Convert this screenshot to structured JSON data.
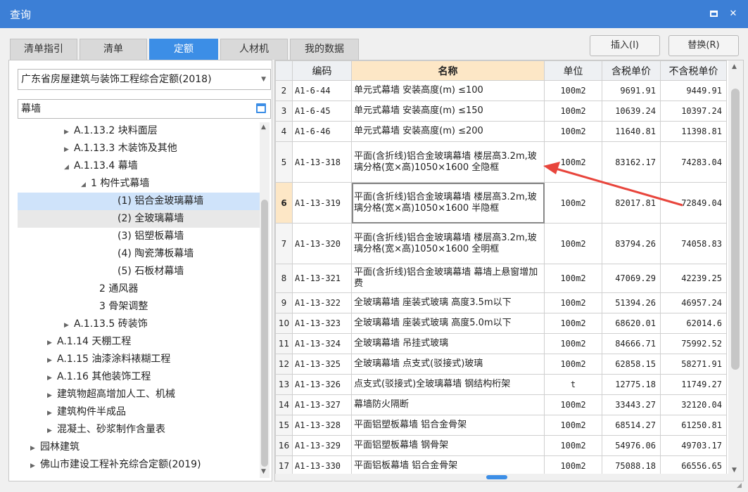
{
  "window": {
    "title": "查询"
  },
  "tabs": [
    {
      "label": "清单指引"
    },
    {
      "label": "清单"
    },
    {
      "label": "定额"
    },
    {
      "label": "人材机"
    },
    {
      "label": "我的数据"
    }
  ],
  "buttons": {
    "insert": "插入(I)",
    "replace": "替换(R)"
  },
  "left": {
    "quota_library": "广东省房屋建筑与装饰工程综合定额(2018)",
    "search_value": "幕墙",
    "tree": [
      {
        "label": "A.1.13.2 块料面层",
        "arrow": "▶"
      },
      {
        "label": "A.1.13.3 木装饰及其他",
        "arrow": "▶"
      },
      {
        "label": "A.1.13.4 幕墙",
        "arrow": "◢"
      },
      {
        "label": "1 构件式幕墙",
        "arrow": "◢"
      },
      {
        "label": "(1) 铝合金玻璃幕墙",
        "arrow": ""
      },
      {
        "label": "(2) 全玻璃幕墙",
        "arrow": ""
      },
      {
        "label": "(3) 铝塑板幕墙",
        "arrow": ""
      },
      {
        "label": "(4) 陶瓷薄板幕墙",
        "arrow": ""
      },
      {
        "label": "(5) 石板材幕墙",
        "arrow": ""
      },
      {
        "label": "2 通风器",
        "arrow": ""
      },
      {
        "label": "3 骨架调整",
        "arrow": ""
      },
      {
        "label": "A.1.13.5 砖装饰",
        "arrow": "▶"
      },
      {
        "label": "A.1.14 天棚工程",
        "arrow": "▶"
      },
      {
        "label": "A.1.15 油漆涂料裱糊工程",
        "arrow": "▶"
      },
      {
        "label": "A.1.16 其他装饰工程",
        "arrow": "▶"
      },
      {
        "label": "建筑物超高增加人工、机械",
        "arrow": "▶"
      },
      {
        "label": "建筑构件半成品",
        "arrow": "▶"
      },
      {
        "label": "混凝土、砂浆制作含量表",
        "arrow": "▶"
      },
      {
        "label": "园林建筑",
        "arrow": "▶"
      },
      {
        "label": "佛山市建设工程补充综合定额(2019)",
        "arrow": "▶"
      }
    ]
  },
  "grid": {
    "headers": [
      "",
      "编码",
      "名称",
      "单位",
      "含税单价",
      "不含税单价"
    ],
    "rows": [
      {
        "idx": "2",
        "code": "A1-6-44",
        "name": "单元式幕墙 安装高度(m) ≤100",
        "unit": "100m2",
        "tax": "9691.91",
        "notax": "9449.91"
      },
      {
        "idx": "3",
        "code": "A1-6-45",
        "name": "单元式幕墙 安装高度(m) ≤150",
        "unit": "100m2",
        "tax": "10639.24",
        "notax": "10397.24"
      },
      {
        "idx": "4",
        "code": "A1-6-46",
        "name": "单元式幕墙 安装高度(m) ≤200",
        "unit": "100m2",
        "tax": "11640.81",
        "notax": "11398.81"
      },
      {
        "idx": "5",
        "code": "A1-13-318",
        "name": "平面(含折线)铝合金玻璃幕墙 楼层高3.2m,玻璃分格(宽×高)1050×1600 全隐框",
        "unit": "100m2",
        "tax": "83162.17",
        "notax": "74283.04"
      },
      {
        "idx": "6",
        "code": "A1-13-319",
        "name": "平面(含折线)铝合金玻璃幕墙 楼层高3.2m,玻璃分格(宽×高)1050×1600 半隐框",
        "unit": "100m2",
        "tax": "82017.81",
        "notax": "72849.04"
      },
      {
        "idx": "7",
        "code": "A1-13-320",
        "name": "平面(含折线)铝合金玻璃幕墙 楼层高3.2m,玻璃分格(宽×高)1050×1600 全明框",
        "unit": "100m2",
        "tax": "83794.26",
        "notax": "74058.83"
      },
      {
        "idx": "8",
        "code": "A1-13-321",
        "name": "平面(含折线)铝合金玻璃幕墙 幕墙上悬窗增加费",
        "unit": "100m2",
        "tax": "47069.29",
        "notax": "42239.25"
      },
      {
        "idx": "9",
        "code": "A1-13-322",
        "name": "全玻璃幕墙 座装式玻璃 高度3.5m以下",
        "unit": "100m2",
        "tax": "51394.26",
        "notax": "46957.24"
      },
      {
        "idx": "10",
        "code": "A1-13-323",
        "name": "全玻璃幕墙 座装式玻璃 高度5.0m以下",
        "unit": "100m2",
        "tax": "68620.01",
        "notax": "62014.6"
      },
      {
        "idx": "11",
        "code": "A1-13-324",
        "name": "全玻璃幕墙 吊挂式玻璃",
        "unit": "100m2",
        "tax": "84666.71",
        "notax": "75992.52"
      },
      {
        "idx": "12",
        "code": "A1-13-325",
        "name": "全玻璃幕墙 点支式(驳接式)玻璃",
        "unit": "100m2",
        "tax": "62858.15",
        "notax": "58271.91"
      },
      {
        "idx": "13",
        "code": "A1-13-326",
        "name": "点支式(驳接式)全玻璃幕墙 钢结构桁架",
        "unit": "t",
        "tax": "12775.18",
        "notax": "11749.27"
      },
      {
        "idx": "14",
        "code": "A1-13-327",
        "name": "幕墙防火隔断",
        "unit": "100m2",
        "tax": "33443.27",
        "notax": "32120.04"
      },
      {
        "idx": "15",
        "code": "A1-13-328",
        "name": "平面铝塑板幕墙 铝合金骨架",
        "unit": "100m2",
        "tax": "68514.27",
        "notax": "61250.81"
      },
      {
        "idx": "16",
        "code": "A1-13-329",
        "name": "平面铝塑板幕墙 钢骨架",
        "unit": "100m2",
        "tax": "54976.06",
        "notax": "49703.17"
      },
      {
        "idx": "17",
        "code": "A1-13-330",
        "name": "平面铝板幕墙 铝合金骨架",
        "unit": "100m2",
        "tax": "75088.18",
        "notax": "66556.65"
      }
    ]
  },
  "colors": {
    "accent": "#3c8ee6",
    "titlebar": "#3c7fd6",
    "annotation": "#e8453c"
  }
}
